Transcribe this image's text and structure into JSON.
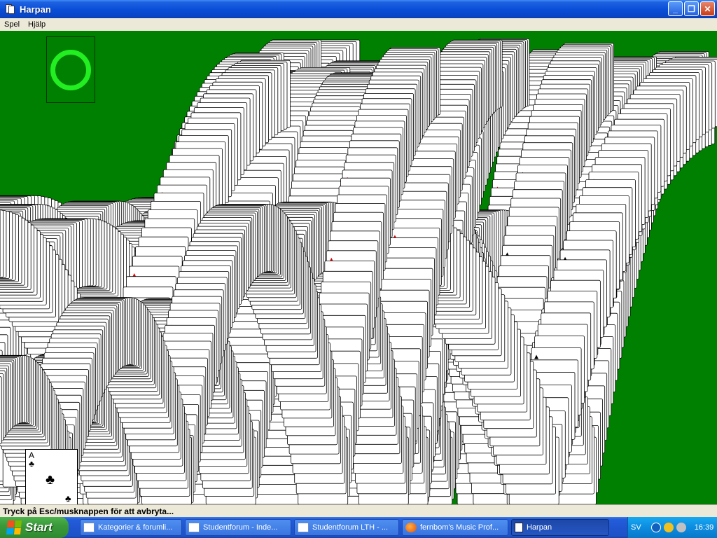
{
  "window": {
    "title": "Harpan",
    "controls": {
      "minimize": "_",
      "maximize": "❐",
      "close": "✕"
    }
  },
  "menu": [
    {
      "label": "Spel"
    },
    {
      "label": "Hjälp"
    }
  ],
  "final_card": {
    "rank": "A",
    "suit": "♣"
  },
  "statusbar": {
    "text": "Tryck på Esc/musknappen för att avbryta..."
  },
  "taskbar": {
    "start_label": "Start",
    "items": [
      {
        "label": "Kategorier & forumli...",
        "icon": "ie-window-icon",
        "active": false
      },
      {
        "label": "Studentforum - Inde...",
        "icon": "ie-window-icon",
        "active": false
      },
      {
        "label": "Studentforum LTH - ...",
        "icon": "ie-window-icon",
        "active": false
      },
      {
        "label": "fernbom's Music Prof...",
        "icon": "firefox-icon",
        "active": false
      },
      {
        "label": "Harpan",
        "icon": "solitaire-icon",
        "active": true
      }
    ],
    "tray": {
      "language": "SV",
      "time": "16:39"
    }
  },
  "colors": {
    "felt": "#008000",
    "deck_ring": "#22ee22",
    "card_red": "#e00000",
    "card_black": "#000000",
    "titlebar": "#0a4fd8",
    "taskbar": "#245edb"
  }
}
